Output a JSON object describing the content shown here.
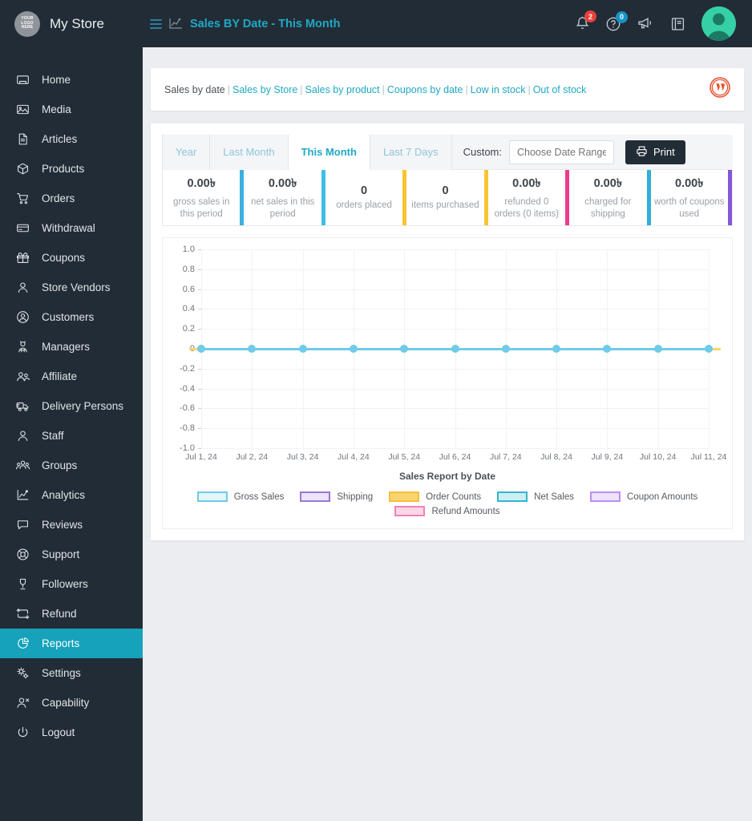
{
  "header": {
    "logo_text_lines": [
      "YOUR",
      "LOGO",
      "HERE"
    ],
    "store_name": "My Store",
    "page_title": "Sales BY Date - This Month",
    "notification_badge": "2",
    "help_badge": "0",
    "icons": [
      "menu-icon",
      "chart-icon",
      "bell-icon",
      "help-icon",
      "megaphone-icon",
      "book-icon",
      "avatar"
    ]
  },
  "sidebar": {
    "items": [
      {
        "label": "Home",
        "icon": "home-icon",
        "active": false
      },
      {
        "label": "Media",
        "icon": "media-icon",
        "active": false
      },
      {
        "label": "Articles",
        "icon": "document-icon",
        "active": false
      },
      {
        "label": "Products",
        "icon": "box-icon",
        "active": false
      },
      {
        "label": "Orders",
        "icon": "cart-icon",
        "active": false
      },
      {
        "label": "Withdrawal",
        "icon": "card-icon",
        "active": false
      },
      {
        "label": "Coupons",
        "icon": "gift-icon",
        "active": false
      },
      {
        "label": "Store Vendors",
        "icon": "user-icon",
        "active": false
      },
      {
        "label": "Customers",
        "icon": "user-circle-icon",
        "active": false
      },
      {
        "label": "Managers",
        "icon": "manager-icon",
        "active": false
      },
      {
        "label": "Affiliate",
        "icon": "users-icon",
        "active": false
      },
      {
        "label": "Delivery Persons",
        "icon": "truck-icon",
        "active": false
      },
      {
        "label": "Staff",
        "icon": "user-icon",
        "active": false
      },
      {
        "label": "Groups",
        "icon": "group-icon",
        "active": false
      },
      {
        "label": "Analytics",
        "icon": "analytics-icon",
        "active": false
      },
      {
        "label": "Reviews",
        "icon": "comment-icon",
        "active": false
      },
      {
        "label": "Support",
        "icon": "lifebuoy-icon",
        "active": false
      },
      {
        "label": "Followers",
        "icon": "follower-icon",
        "active": false
      },
      {
        "label": "Refund",
        "icon": "refund-icon",
        "active": false
      },
      {
        "label": "Reports",
        "icon": "pie-chart-icon",
        "active": true
      },
      {
        "label": "Settings",
        "icon": "gear-icon",
        "active": false
      },
      {
        "label": "Capability",
        "icon": "user-x-icon",
        "active": false
      },
      {
        "label": "Logout",
        "icon": "power-icon",
        "active": false
      }
    ]
  },
  "breadcrumb": {
    "items": [
      {
        "label": "Sales by date",
        "current": true
      },
      {
        "label": "Sales by Store",
        "current": false
      },
      {
        "label": "Sales by product",
        "current": false
      },
      {
        "label": "Coupons by date",
        "current": false
      },
      {
        "label": "Low in stock",
        "current": false
      },
      {
        "label": "Out of stock",
        "current": false
      }
    ],
    "separator": "|",
    "wordpress_icon": "wordpress-icon"
  },
  "report": {
    "tabs": [
      {
        "label": "Year",
        "active": false
      },
      {
        "label": "Last Month",
        "active": false
      },
      {
        "label": "This Month",
        "active": true
      },
      {
        "label": "Last 7 Days",
        "active": false
      }
    ],
    "custom_label": "Custom:",
    "date_range_placeholder": "Choose Date Range ...",
    "date_range_value": "",
    "print_label": "Print",
    "print_icon": "printer-icon",
    "stats": [
      {
        "value": "0.00৳",
        "label": "gross sales in this period",
        "accent": "#3cb0e0"
      },
      {
        "value": "0.00৳",
        "label": "net sales in this period",
        "accent": "#3ebfe6"
      },
      {
        "value": "0",
        "label": "orders placed",
        "accent": "#f7c433"
      },
      {
        "value": "0",
        "label": "items purchased",
        "accent": "#f7c433"
      },
      {
        "value": "0.00৳",
        "label": "refunded 0 orders (0 items)",
        "accent": "#ec3b8b"
      },
      {
        "value": "0.00৳",
        "label": "charged for shipping",
        "accent": "#2fafd8"
      },
      {
        "value": "0.00৳",
        "label": "worth of coupons used",
        "accent": "#8357d8"
      }
    ]
  },
  "chart_data": {
    "type": "line",
    "title": "Sales Report by Date",
    "xlabel": "",
    "ylabel": "",
    "grid": true,
    "legend_position": "bottom",
    "ylim": [
      -1.0,
      1.0
    ],
    "yticks": [
      "1.0",
      "0.8",
      "0.6",
      "0.4",
      "0.2",
      "0",
      "-0.2",
      "-0.4",
      "-0.6",
      "-0.8",
      "-1.0"
    ],
    "categories": [
      "Jul 1, 24",
      "Jul 2, 24",
      "Jul 3, 24",
      "Jul 4, 24",
      "Jul 5, 24",
      "Jul 6, 24",
      "Jul 7, 24",
      "Jul 8, 24",
      "Jul 9, 24",
      "Jul 10, 24",
      "Jul 11, 24"
    ],
    "series": [
      {
        "name": "Gross Sales",
        "color": "#6fcbe8",
        "fill": "#e4f6fc",
        "values": [
          0,
          0,
          0,
          0,
          0,
          0,
          0,
          0,
          0,
          0,
          0
        ]
      },
      {
        "name": "Shipping",
        "color": "#9b76d8",
        "fill": "#ece4fa",
        "values": [
          0,
          0,
          0,
          0,
          0,
          0,
          0,
          0,
          0,
          0,
          0
        ]
      },
      {
        "name": "Order Counts",
        "color": "#f5bf3f",
        "fill": "#fbd46d",
        "values": [
          0,
          0,
          0,
          0,
          0,
          0,
          0,
          0,
          0,
          0,
          0
        ]
      },
      {
        "name": "Net Sales",
        "color": "#33b6cc",
        "fill": "#cdeff3",
        "values": [
          0,
          0,
          0,
          0,
          0,
          0,
          0,
          0,
          0,
          0,
          0
        ]
      },
      {
        "name": "Coupon Amounts",
        "color": "#b98ff5",
        "fill": "#eee2fd",
        "values": [
          0,
          0,
          0,
          0,
          0,
          0,
          0,
          0,
          0,
          0,
          0
        ]
      },
      {
        "name": "Refund Amounts",
        "color": "#f082b6",
        "fill": "#fbd7e7",
        "values": [
          0,
          0,
          0,
          0,
          0,
          0,
          0,
          0,
          0,
          0,
          0
        ]
      }
    ]
  }
}
